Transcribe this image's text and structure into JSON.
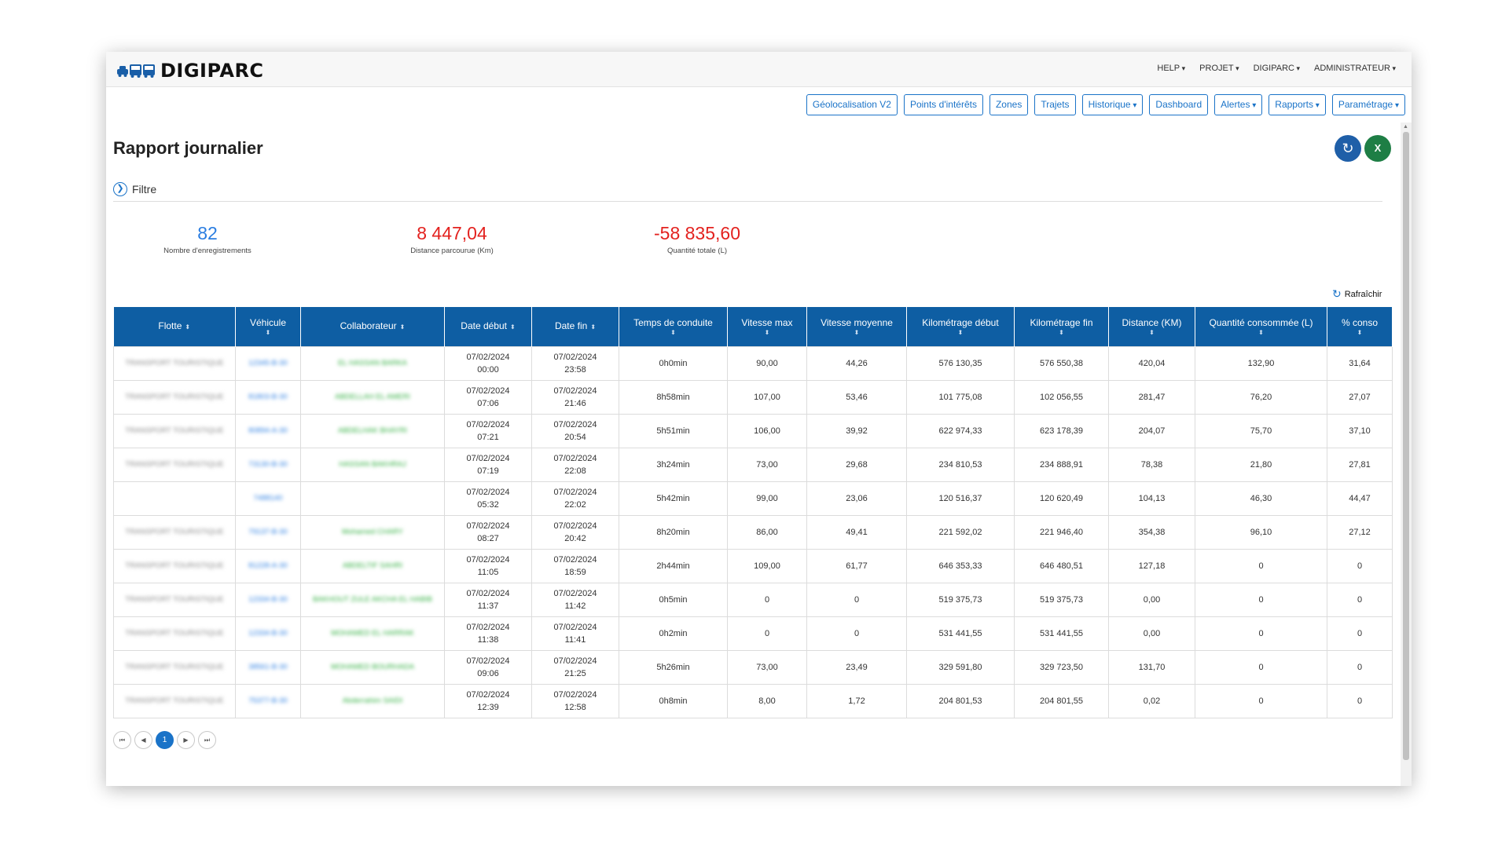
{
  "app": {
    "name": "DIGIPARC",
    "top_menu": [
      "HELP",
      "PROJET",
      "DIGIPARC",
      "ADMINISTRATEUR"
    ]
  },
  "nav_buttons": [
    {
      "label": "Géolocalisation V2",
      "dropdown": false
    },
    {
      "label": "Points d'intérêts",
      "dropdown": false
    },
    {
      "label": "Zones",
      "dropdown": false
    },
    {
      "label": "Trajets",
      "dropdown": false
    },
    {
      "label": "Historique",
      "dropdown": true
    },
    {
      "label": "Dashboard",
      "dropdown": false
    },
    {
      "label": "Alertes",
      "dropdown": true
    },
    {
      "label": "Rapports",
      "dropdown": true
    },
    {
      "label": "Paramétrage",
      "dropdown": true
    }
  ],
  "page": {
    "title": "Rapport journalier",
    "filter_label": "Filtre",
    "refresh_label": "Rafraîchir",
    "excel_label": "X"
  },
  "stats": [
    {
      "value": "82",
      "label": "Nombre d'enregistrements",
      "color": "#2a7de1"
    },
    {
      "value": "8 447,04",
      "label": "Distance parcourue (Km)",
      "color": "#e3221f"
    },
    {
      "value": "-58 835,60",
      "label": "Quantité totale (L)",
      "color": "#e3221f"
    }
  ],
  "table": {
    "columns": [
      {
        "label": "Flotte",
        "sort": "inline"
      },
      {
        "label": "Véhicule",
        "sort": "below"
      },
      {
        "label": "Collaborateur",
        "sort": "inline"
      },
      {
        "label": "Date début",
        "sort": "inline"
      },
      {
        "label": "Date fin",
        "sort": "inline"
      },
      {
        "label": "Temps de conduite",
        "sort": "below"
      },
      {
        "label": "Vitesse max",
        "sort": "below"
      },
      {
        "label": "Vitesse moyenne",
        "sort": "below"
      },
      {
        "label": "Kilométrage début",
        "sort": "below"
      },
      {
        "label": "Kilométrage fin",
        "sort": "below"
      },
      {
        "label": "Distance (KM)",
        "sort": "below"
      },
      {
        "label": "Quantité consommée (L)",
        "sort": "below"
      },
      {
        "label": "% conso",
        "sort": "below"
      }
    ],
    "rows": [
      {
        "flotte": "TRANSPORT TOURISTIQUE",
        "vehicule": "12345-B-30",
        "collaborateur": "EL HASSAN BARKA",
        "debut": [
          "07/02/2024",
          "00:00"
        ],
        "fin": [
          "07/02/2024",
          "23:58"
        ],
        "temps": "0h0min",
        "vmax": "90,00",
        "vmoy": "44,26",
        "kmdeb": "576 130,35",
        "kmfin": "576 550,38",
        "dist": "420,04",
        "qte": "132,90",
        "conso": "31,64"
      },
      {
        "flotte": "TRANSPORT TOURISTIQUE",
        "vehicule": "81803-B-30",
        "collaborateur": "ABDELLAH EL AMERI",
        "debut": [
          "07/02/2024",
          "07:06"
        ],
        "fin": [
          "07/02/2024",
          "21:46"
        ],
        "temps": "8h58min",
        "vmax": "107,00",
        "vmoy": "53,46",
        "kmdeb": "101 775,08",
        "kmfin": "102 056,55",
        "dist": "281,47",
        "qte": "76,20",
        "conso": "27,07"
      },
      {
        "flotte": "TRANSPORT TOURISTIQUE",
        "vehicule": "80894-A-30",
        "collaborateur": "ABDELHAK BHAYRI",
        "debut": [
          "07/02/2024",
          "07:21"
        ],
        "fin": [
          "07/02/2024",
          "20:54"
        ],
        "temps": "5h51min",
        "vmax": "106,00",
        "vmoy": "39,92",
        "kmdeb": "622 974,33",
        "kmfin": "623 178,39",
        "dist": "204,07",
        "qte": "75,70",
        "conso": "37,10"
      },
      {
        "flotte": "TRANSPORT TOURISTIQUE",
        "vehicule": "73130-B-30",
        "collaborateur": "HASSAN BAKHRAJ",
        "debut": [
          "07/02/2024",
          "07:19"
        ],
        "fin": [
          "07/02/2024",
          "22:08"
        ],
        "temps": "3h24min",
        "vmax": "73,00",
        "vmoy": "29,68",
        "kmdeb": "234 810,53",
        "kmfin": "234 888,91",
        "dist": "78,38",
        "qte": "21,80",
        "conso": "27,81"
      },
      {
        "flotte": "",
        "vehicule": "7488140",
        "collaborateur": "",
        "debut": [
          "07/02/2024",
          "05:32"
        ],
        "fin": [
          "07/02/2024",
          "22:02"
        ],
        "temps": "5h42min",
        "vmax": "99,00",
        "vmoy": "23,06",
        "kmdeb": "120 516,37",
        "kmfin": "120 620,49",
        "dist": "104,13",
        "qte": "46,30",
        "conso": "44,47"
      },
      {
        "flotte": "TRANSPORT TOURISTIQUE",
        "vehicule": "79137-B-30",
        "collaborateur": "Mohamed CHARY",
        "debut": [
          "07/02/2024",
          "08:27"
        ],
        "fin": [
          "07/02/2024",
          "20:42"
        ],
        "temps": "8h20min",
        "vmax": "86,00",
        "vmoy": "49,41",
        "kmdeb": "221 592,02",
        "kmfin": "221 946,40",
        "dist": "354,38",
        "qte": "96,10",
        "conso": "27,12"
      },
      {
        "flotte": "TRANSPORT TOURISTIQUE",
        "vehicule": "81228-A-30",
        "collaborateur": "ABDELTIF SAHRI",
        "debut": [
          "07/02/2024",
          "11:05"
        ],
        "fin": [
          "07/02/2024",
          "18:59"
        ],
        "temps": "2h44min",
        "vmax": "109,00",
        "vmoy": "61,77",
        "kmdeb": "646 353,33",
        "kmfin": "646 480,51",
        "dist": "127,18",
        "qte": "0",
        "conso": "0"
      },
      {
        "flotte": "TRANSPORT TOURISTIQUE",
        "vehicule": "12334-B-30",
        "collaborateur": "BAKHOUT ZULE AKCHA EL HABIB",
        "debut": [
          "07/02/2024",
          "11:37"
        ],
        "fin": [
          "07/02/2024",
          "11:42"
        ],
        "temps": "0h5min",
        "vmax": "0",
        "vmoy": "0",
        "kmdeb": "519 375,73",
        "kmfin": "519 375,73",
        "dist": "0,00",
        "qte": "0",
        "conso": "0"
      },
      {
        "flotte": "TRANSPORT TOURISTIQUE",
        "vehicule": "12334-B-30",
        "collaborateur": "MOHAMED EL HARRAK",
        "debut": [
          "07/02/2024",
          "11:38"
        ],
        "fin": [
          "07/02/2024",
          "11:41"
        ],
        "temps": "0h2min",
        "vmax": "0",
        "vmoy": "0",
        "kmdeb": "531 441,55",
        "kmfin": "531 441,55",
        "dist": "0,00",
        "qte": "0",
        "conso": "0"
      },
      {
        "flotte": "TRANSPORT TOURISTIQUE",
        "vehicule": "38561-B-30",
        "collaborateur": "MOHAMED BOURHADA",
        "debut": [
          "07/02/2024",
          "09:06"
        ],
        "fin": [
          "07/02/2024",
          "21:25"
        ],
        "temps": "5h26min",
        "vmax": "73,00",
        "vmoy": "23,49",
        "kmdeb": "329 591,80",
        "kmfin": "329 723,50",
        "dist": "131,70",
        "qte": "0",
        "conso": "0"
      },
      {
        "flotte": "TRANSPORT TOURISTIQUE",
        "vehicule": "75377-B-30",
        "collaborateur": "Abderrahim SAIDI",
        "debut": [
          "07/02/2024",
          "12:39"
        ],
        "fin": [
          "07/02/2024",
          "12:58"
        ],
        "temps": "0h8min",
        "vmax": "8,00",
        "vmoy": "1,72",
        "kmdeb": "204 801,53",
        "kmfin": "204 801,55",
        "dist": "0,02",
        "qte": "0",
        "conso": "0"
      }
    ]
  },
  "pagination": {
    "first": "⏮",
    "prev": "◀",
    "current": "1",
    "next": "▶",
    "last": "⏭"
  },
  "colors": {
    "primary": "#1a73c8",
    "header": "#0e5ea3",
    "negative": "#e3221f",
    "excel": "#1e7e45"
  }
}
